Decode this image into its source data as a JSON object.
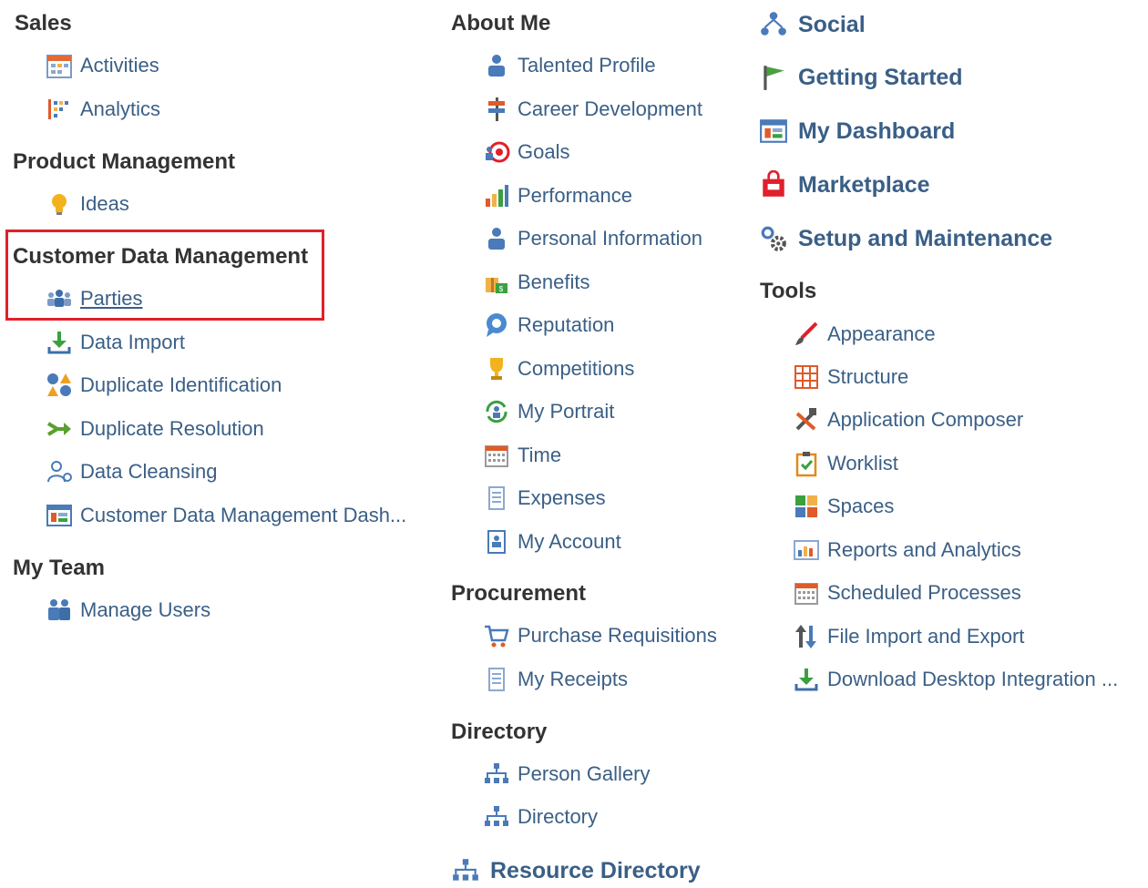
{
  "col1": {
    "sales": {
      "title": "Sales",
      "items": [
        "Activities",
        "Analytics"
      ]
    },
    "product_management": {
      "title": "Product Management",
      "items": [
        "Ideas"
      ]
    },
    "customer_data_management": {
      "title": "Customer Data Management",
      "items": [
        "Parties",
        "Data Import",
        "Duplicate Identification",
        "Duplicate Resolution",
        "Data Cleansing",
        "Customer Data Management Dash..."
      ]
    },
    "my_team": {
      "title": "My Team",
      "items": [
        "Manage Users"
      ]
    }
  },
  "col2": {
    "about_me": {
      "title": "About Me",
      "items": [
        "Talented Profile",
        "Career Development",
        "Goals",
        "Performance",
        "Personal Information",
        "Benefits",
        "Reputation",
        "Competitions",
        "My Portrait",
        "Time",
        "Expenses",
        "My Account"
      ]
    },
    "procurement": {
      "title": "Procurement",
      "items": [
        "Purchase Requisitions",
        "My Receipts"
      ]
    },
    "directory": {
      "title": "Directory",
      "items": [
        "Person Gallery",
        "Directory"
      ]
    },
    "resource_directory": "Resource Directory"
  },
  "col3": {
    "top_items": [
      "Social",
      "Getting Started",
      "My Dashboard",
      "Marketplace",
      "Setup and Maintenance"
    ],
    "tools": {
      "title": "Tools",
      "items": [
        "Appearance",
        "Structure",
        "Application Composer",
        "Worklist",
        "Spaces",
        "Reports and Analytics",
        "Scheduled Processes",
        "File Import and Export",
        "Download Desktop Integration ..."
      ]
    }
  },
  "colors": {
    "link": "#3a5f86",
    "heading": "#333333",
    "highlight": "#e0202a"
  }
}
